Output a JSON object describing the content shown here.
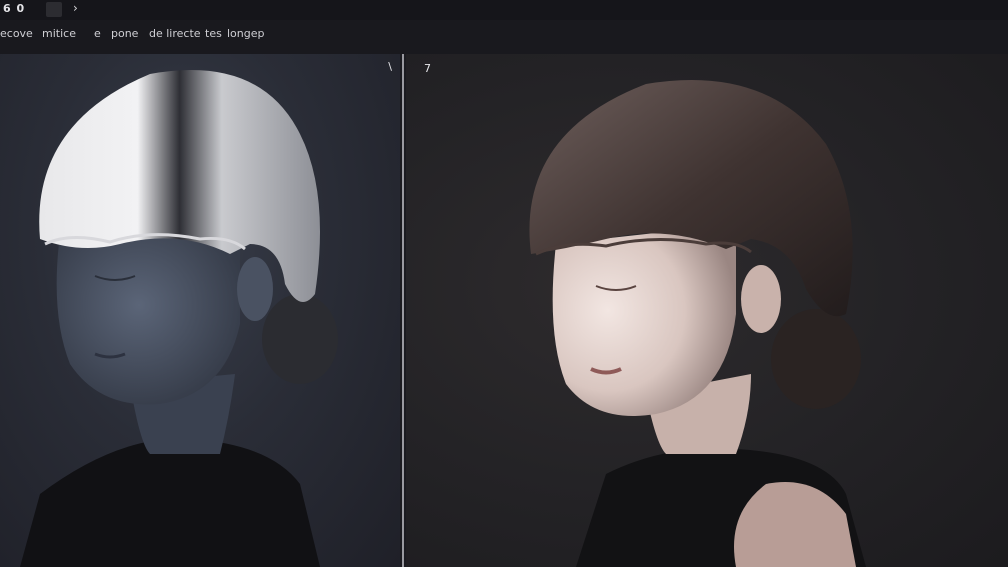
{
  "topbar": {
    "label": "6 0",
    "chevron": "›",
    "thumb_icon": "image-thumbnail-icon"
  },
  "menu": {
    "items": [
      "ecove",
      "mitice",
      "e",
      "pone",
      "de lirecte",
      "tes",
      "longep"
    ]
  },
  "left_panel": {
    "corner_glyph": "\\",
    "image": "portrait-monochrome-blue"
  },
  "right_panel": {
    "corner_glyph": "7",
    "image": "portrait-color-dark"
  },
  "colors": {
    "app_bg": "#1a1a1e",
    "left_bg": "#2a2d37",
    "right_bg": "#242326",
    "divider": "#9a9aa0"
  }
}
